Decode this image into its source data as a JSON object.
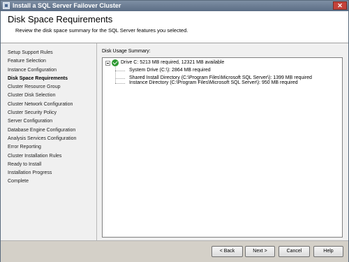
{
  "window": {
    "title": "Install a SQL Server Failover Cluster"
  },
  "header": {
    "title": "Disk Space Requirements",
    "subtitle": "Review the disk space summary for the SQL Server features you selected."
  },
  "sidebar": {
    "items": [
      {
        "label": "Setup Support Rules"
      },
      {
        "label": "Feature Selection"
      },
      {
        "label": "Instance Configuration"
      },
      {
        "label": "Disk Space Requirements"
      },
      {
        "label": "Cluster Resource Group"
      },
      {
        "label": "Cluster Disk Selection"
      },
      {
        "label": "Cluster Network Configuration"
      },
      {
        "label": "Cluster Security Policy"
      },
      {
        "label": "Server Configuration"
      },
      {
        "label": "Database Engine Configuration"
      },
      {
        "label": "Analysis Services Configuration"
      },
      {
        "label": "Error Reporting"
      },
      {
        "label": "Cluster Installation Rules"
      },
      {
        "label": "Ready to Install"
      },
      {
        "label": "Installation Progress"
      },
      {
        "label": "Complete"
      }
    ]
  },
  "main": {
    "summary_label": "Disk Usage Summary:",
    "tree": {
      "drive": "Drive C: 5213 MB required, 12321 MB available",
      "children": [
        "System Drive (C:\\): 2864 MB required",
        "Shared Install Directory (C:\\Program Files\\Microsoft SQL Server\\): 1399 MB required",
        "Instance Directory (C:\\Program Files\\Microsoft SQL Server\\): 950 MB required"
      ]
    }
  },
  "footer": {
    "back": "< Back",
    "next": "Next >",
    "cancel": "Cancel",
    "help": "Help"
  }
}
